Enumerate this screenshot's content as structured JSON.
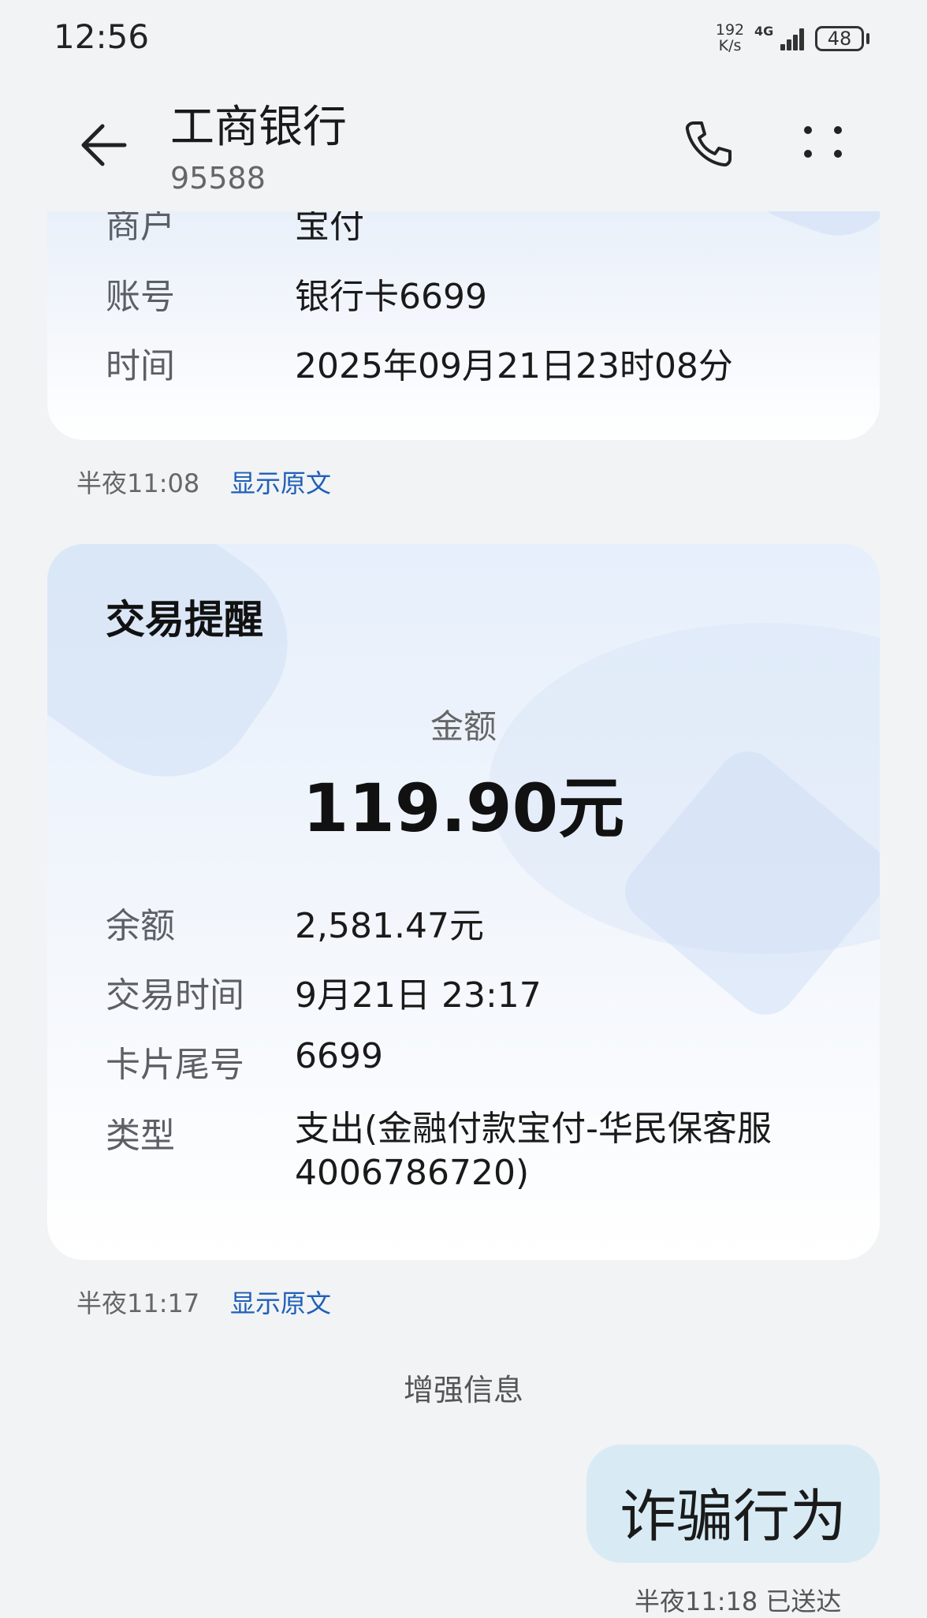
{
  "status_bar": {
    "time": "12:56",
    "speed_value": "192",
    "speed_unit": "K/s",
    "network": "4G",
    "battery": "48"
  },
  "header": {
    "title": "工商银行",
    "subtitle": "95588",
    "icons": [
      "back-arrow-icon",
      "phone-icon",
      "more-icon"
    ]
  },
  "message1": {
    "rows": [
      {
        "label": "商户",
        "value": "宝付"
      },
      {
        "label": "账号",
        "value": "银行卡6699"
      },
      {
        "label": "时间",
        "value": "2025年09月21日23时08分"
      }
    ],
    "time": "半夜11:08",
    "link": "显示原文"
  },
  "message2": {
    "title": "交易提醒",
    "amount_label": "金额",
    "amount": "119.90元",
    "rows": [
      {
        "label": "余额",
        "value": "2,581.47元"
      },
      {
        "label": "交易时间",
        "value": "9月21日 23:17"
      },
      {
        "label": "卡片尾号",
        "value": "6699"
      },
      {
        "label": "类型",
        "value": "支出(金融付款宝付-华民保客服4006786720)"
      }
    ],
    "time": "半夜11:17",
    "link": "显示原文"
  },
  "enhanced_info": "增强信息",
  "sent_message": {
    "text": "诈骗行为",
    "meta": "半夜11:18 已送达"
  },
  "colors": {
    "background": "#f1f3f5",
    "link": "#1f5fb8",
    "bubble": "#d8ebf4"
  }
}
